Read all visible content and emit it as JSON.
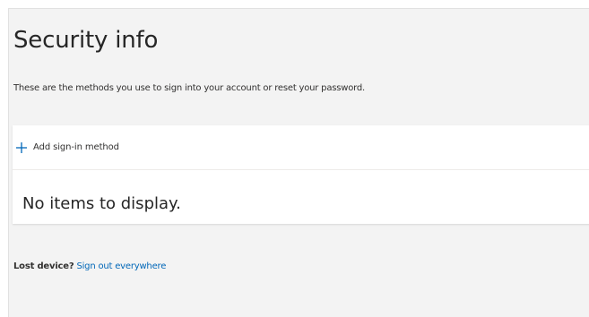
{
  "header": {
    "title": "Security info",
    "subtitle": "These are the methods you use to sign into your account or reset your password."
  },
  "methods": {
    "add_label": "Add sign-in method",
    "add_icon": "plus-icon",
    "empty_message": "No items to display."
  },
  "footer": {
    "lost_device_label": "Lost device?",
    "sign_out_link": "Sign out everywhere"
  },
  "colors": {
    "accent": "#0067b8",
    "page_background": "#f3f3f3",
    "card_background": "#ffffff"
  }
}
